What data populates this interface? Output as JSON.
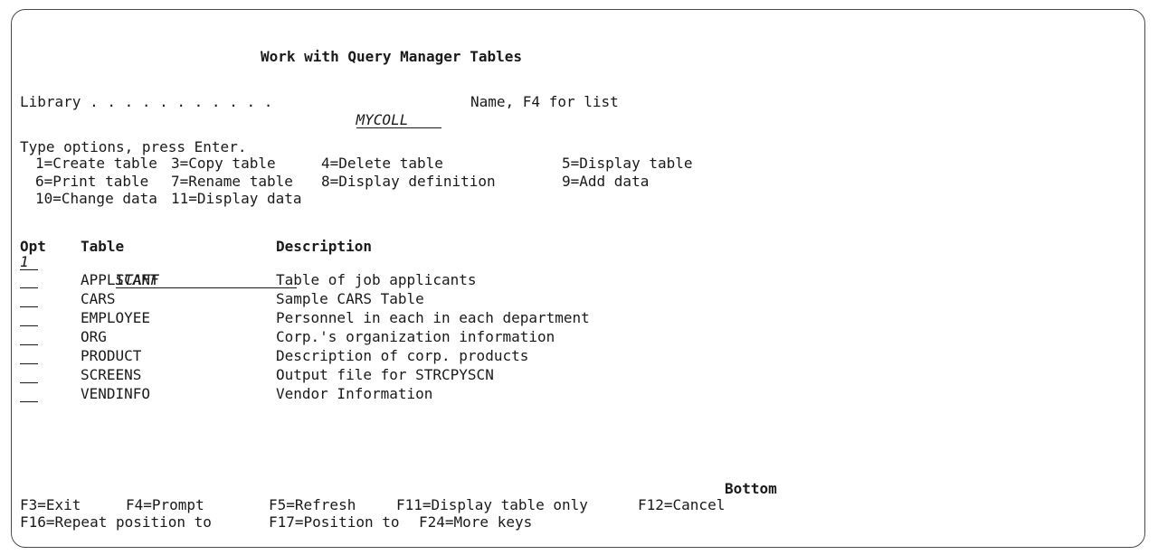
{
  "screen": {
    "title": "Work with Query Manager Tables",
    "library_label": "Library . . . . . . . . . . .",
    "library_value": "MYCOLL",
    "library_hint": "Name, F4 for list",
    "instructions": "Type options, press Enter.",
    "options": [
      "1=Create table",
      "3=Copy table",
      "4=Delete table",
      "5=Display table",
      "6=Print table",
      "7=Rename table",
      "8=Display definition",
      "9=Add data",
      "10=Change data",
      "11=Display data"
    ],
    "columns": {
      "opt": "Opt",
      "table": "Table",
      "description": "Description"
    },
    "position_row": {
      "opt": "1",
      "table": "STAFF"
    },
    "rows": [
      {
        "opt": "",
        "table": "APPLICANT",
        "description": "Table of job applicants"
      },
      {
        "opt": "",
        "table": "CARS",
        "description": "Sample CARS Table"
      },
      {
        "opt": "",
        "table": "EMPLOYEE",
        "description": "Personnel in each in each department"
      },
      {
        "opt": "",
        "table": "ORG",
        "description": "Corp.'s organization information"
      },
      {
        "opt": "",
        "table": "PRODUCT",
        "description": "Description of corp. products"
      },
      {
        "opt": "",
        "table": "SCREENS",
        "description": "Output file for STRCPYSCN"
      },
      {
        "opt": "",
        "table": "VENDINFO",
        "description": "Vendor Information"
      }
    ],
    "more_indicator": "Bottom",
    "function_keys": [
      "F3=Exit",
      "F4=Prompt",
      "F5=Refresh",
      "F11=Display table only",
      "F12=Cancel",
      "F16=Repeat position to",
      "F17=Position to",
      "F24=More keys"
    ]
  }
}
